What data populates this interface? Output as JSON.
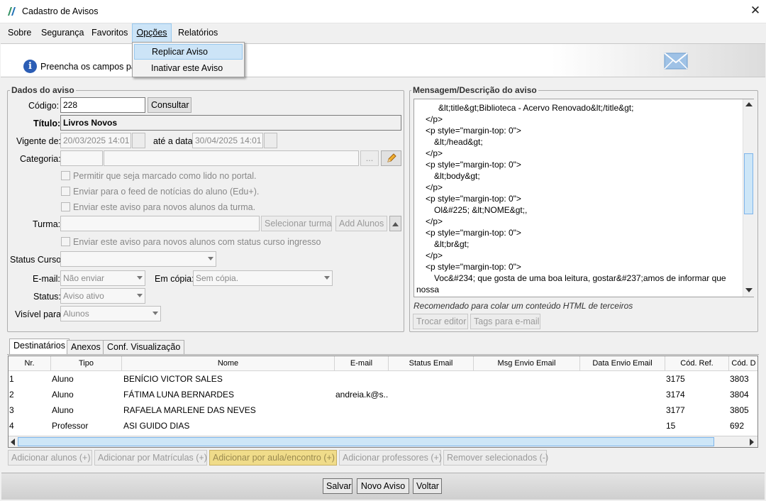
{
  "window": {
    "title": "Cadastro de Avisos",
    "close_glyph": "✕"
  },
  "menu": {
    "items": [
      {
        "label": "Sobre"
      },
      {
        "label": "Segurança"
      },
      {
        "label": "Favoritos"
      },
      {
        "label": "Opções"
      },
      {
        "label": "Relatórios"
      }
    ],
    "dropdown": [
      {
        "label": "Replicar Aviso"
      },
      {
        "label": "Inativar este Aviso"
      }
    ]
  },
  "banner": {
    "text": "Preencha os campos par",
    "info_glyph": "i"
  },
  "dados": {
    "legend": "Dados do aviso",
    "codigo_label": "Código:",
    "codigo_value": "228",
    "consultar_label": "Consultar",
    "titulo_label": "Título:",
    "titulo_value": "Livros Novos",
    "vigente_label": "Vigente de:",
    "vigente_value": "20/03/2025 14:01",
    "ate_label": "até a data:",
    "ate_value": "30/04/2025 14:01",
    "categoria_label": "Categoria:",
    "ellipsis": "...",
    "checks": [
      "Permitir que seja marcado como lido no portal.",
      "Enviar para o feed de notícias do aluno (Edu+).",
      "Enviar este aviso para novos alunos da turma."
    ],
    "turma_label": "Turma:",
    "selecionar_turma": "Selecionar turma",
    "add_alunos": "Add Alunos",
    "check_ingresso": "Enviar este aviso para novos alunos com status curso ingresso",
    "status_curso_label": "Status Curso:",
    "email_label": "E-mail:",
    "email_value": "Não enviar",
    "copia_label": "Em cópia:",
    "copia_value": "Sem cópia.",
    "status_label": "Status:",
    "status_value": "Aviso ativo",
    "visivel_label": "Visível para:",
    "visivel_value": "Alunos"
  },
  "mensagem": {
    "legend": "Mensagem/Descrição do aviso",
    "lines": [
      "    &lt;title&gt;Biblioteca - Acervo Renovado&lt;/title&gt;",
      "</p>",
      "<p style=\"margin-top: 0\">",
      "    &lt;/head&gt;",
      "</p>",
      "<p style=\"margin-top: 0\">",
      "    &lt;body&gt;",
      "</p>",
      "<p style=\"margin-top: 0\">",
      "    Ol&#225; &lt;NOME&gt;,",
      "</p>",
      "<p style=\"margin-top: 0\">",
      "    &lt;br&gt;",
      "</p>",
      "<p style=\"margin-top: 0\">",
      "    Voc&#234; que gosta de uma boa leitura, gostar&#237;amos de informar que",
      "nossa"
    ],
    "hint": "Recomendado para colar um conteúdo HTML de terceiros",
    "trocar_editor": "Trocar editor",
    "tags_email": "Tags para e-mail"
  },
  "tabs": [
    {
      "label": "Destinatários"
    },
    {
      "label": "Anexos"
    },
    {
      "label": "Conf. Visualização"
    }
  ],
  "grid": {
    "columns": [
      "Nr.",
      "Tipo",
      "Nome",
      "E-mail",
      "Status Email",
      "Msg Envio Email",
      "Data Envio Email",
      "Cód. Ref.",
      "Cód. D"
    ],
    "rows": [
      [
        "1",
        "Aluno",
        " BENÍCIO VICTOR SALES",
        "",
        "",
        "",
        "",
        "3175",
        "3803"
      ],
      [
        "2",
        "Aluno",
        "FÁTIMA LUNA BERNARDES",
        "andreia.k@s...",
        "",
        "",
        "",
        "3174",
        "3804"
      ],
      [
        "3",
        "Aluno",
        "RAFAELA MARLENE DAS NEVES",
        "",
        "",
        "",
        "",
        "3177",
        "3805"
      ],
      [
        "4",
        "Professor",
        "ASI GUIDO DIAS",
        "",
        "",
        "",
        "",
        "15",
        "692"
      ]
    ]
  },
  "grid_actions": [
    "Adicionar alunos (+)",
    "Adicionar por Matrículas (+)",
    "Adicionar por aula/encontro (+)",
    "Adicionar professores (+)",
    "Remover selecionados (-)"
  ],
  "bottom": {
    "salvar": "Salvar",
    "novo": "Novo Aviso",
    "voltar": "Voltar"
  },
  "colors": {
    "menu_highlight": "#cce4f7",
    "info_blue": "#2b5db5",
    "highlight_button": "#f0dc8a"
  }
}
